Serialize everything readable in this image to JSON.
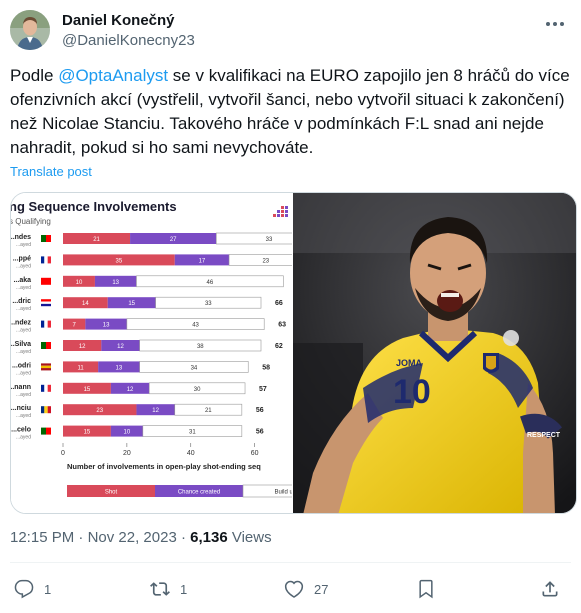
{
  "author": {
    "name": "Daniel Konečný",
    "handle": "@DanielKonecny23"
  },
  "tweet": {
    "text_before": "Podle ",
    "mention": "@OptaAnalyst",
    "text_after": " se v kvalifikaci na EURO zapojilo jen 8 hráčů do více ofenzivních akcí (vystřelil, vytvořil šanci, nebo vytvořil situaci k zakončení) než Nicolae Stanciu. Takového hráče v podmínkách F:L snad ani nejde nahradit, pokud si ho sami nevychováte.",
    "translate_label": "Translate post"
  },
  "meta": {
    "time": "12:15 PM",
    "sep": " · ",
    "date": "Nov 22, 2023",
    "views_count": "6,136",
    "views_label": " Views"
  },
  "actions": {
    "replies": "1",
    "reposts": "1",
    "likes": "27"
  },
  "chart_image": {
    "title": "ng Sequence Involvements",
    "subtitle": "s Qualifying",
    "xlabel": "Number of involvements in open-play shot-ending seq",
    "legend": [
      "Shot",
      "Chance created",
      "Build up t"
    ],
    "colors": {
      "shot": "#d94a5a",
      "chance": "#7a4bc4",
      "build": "#ffffff"
    }
  },
  "chart_data": {
    "type": "bar",
    "stacked": true,
    "orientation": "horizontal",
    "categories": [
      "...ndes",
      "...ppé",
      "...aka",
      "...dric",
      "...ndez",
      "...Silva",
      "...odri",
      "...nann",
      "...nciu",
      "...celo"
    ],
    "sublabels": [
      "...ayed",
      "...ayed",
      "...ayed",
      "...ayed",
      "...ayed",
      "...ayed",
      "...ayed",
      "...ayed",
      "...ayed",
      "...ayed"
    ],
    "flags": [
      "pt",
      "fr",
      "ch",
      "hr",
      "fr",
      "pt",
      "es",
      "fr",
      "ro",
      "pt"
    ],
    "series": [
      {
        "name": "Shot",
        "values": [
          21,
          35,
          10,
          14,
          7,
          12,
          11,
          15,
          23,
          15
        ]
      },
      {
        "name": "Chance created",
        "values": [
          27,
          17,
          13,
          15,
          13,
          12,
          13,
          12,
          12,
          10
        ]
      },
      {
        "name": "Build up t",
        "values": [
          33,
          23,
          46,
          33,
          43,
          38,
          34,
          30,
          21,
          31
        ]
      }
    ],
    "totals": [
      "",
      "",
      "",
      "66",
      "63",
      "62",
      "58",
      "57",
      "56",
      "56"
    ],
    "xticks": [
      "0",
      "20",
      "40",
      "60"
    ],
    "xlim": [
      0,
      62
    ],
    "xlabel": "Number of involvements in open-play shot-ending seq"
  },
  "photo": {
    "shirt_number": "10",
    "armband": "RESPECT",
    "sponsor": "JOMA"
  }
}
